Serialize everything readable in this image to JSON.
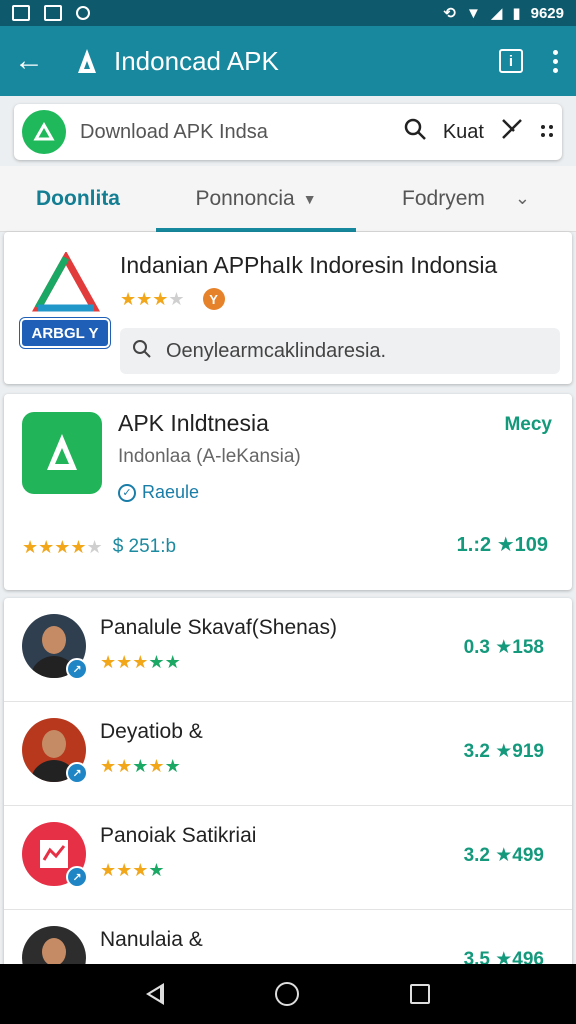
{
  "status_bar": {
    "time": "9629"
  },
  "app_bar": {
    "title": "Indoncad APK"
  },
  "search": {
    "query": "Download APK Indsa",
    "action_label": "Kuat"
  },
  "tabs": [
    {
      "label": "Doonlita"
    },
    {
      "label": "Ponnoncia"
    },
    {
      "label": "Fodryem"
    }
  ],
  "featured": {
    "title": "Indanian APPhaIk Indoresin Indonsia",
    "badge": "ARBGL Y",
    "small_badge": "Y",
    "search_placeholder": "Oenylearmcaklindaresia."
  },
  "app_card": {
    "title": "APK Inldtnesia",
    "subtitle": "Indonlaa (A-leKansia)",
    "verified": "Raeule",
    "tag": "Mecy",
    "size": "$ 251:b",
    "rating": "1.:2 ★109"
  },
  "list": [
    {
      "name": "Panalule Skavaf(Shenas)",
      "rating": "0.3 ★158",
      "stars": 5,
      "gold": 3,
      "avatar_color": "#2f3f50"
    },
    {
      "name": "Deyatiob &",
      "rating": "3.2 ★919",
      "stars": 5,
      "gold": 2,
      "avatar_color": "#b8381e"
    },
    {
      "name": "Panoiak Satikriai",
      "rating": "3.2 ★499",
      "stars": 4,
      "gold": 3,
      "avatar_color": "#e63046"
    },
    {
      "name": "Nanulaia &",
      "rating": "3.5 ★496",
      "stars": 5,
      "gold": 3,
      "avatar_color": "#2d2d2d"
    }
  ],
  "colors": {
    "app_bar": "#17889e",
    "status_bar": "#0e5a6c",
    "accent_green": "#15997c",
    "star_gold": "#f2a71b"
  }
}
